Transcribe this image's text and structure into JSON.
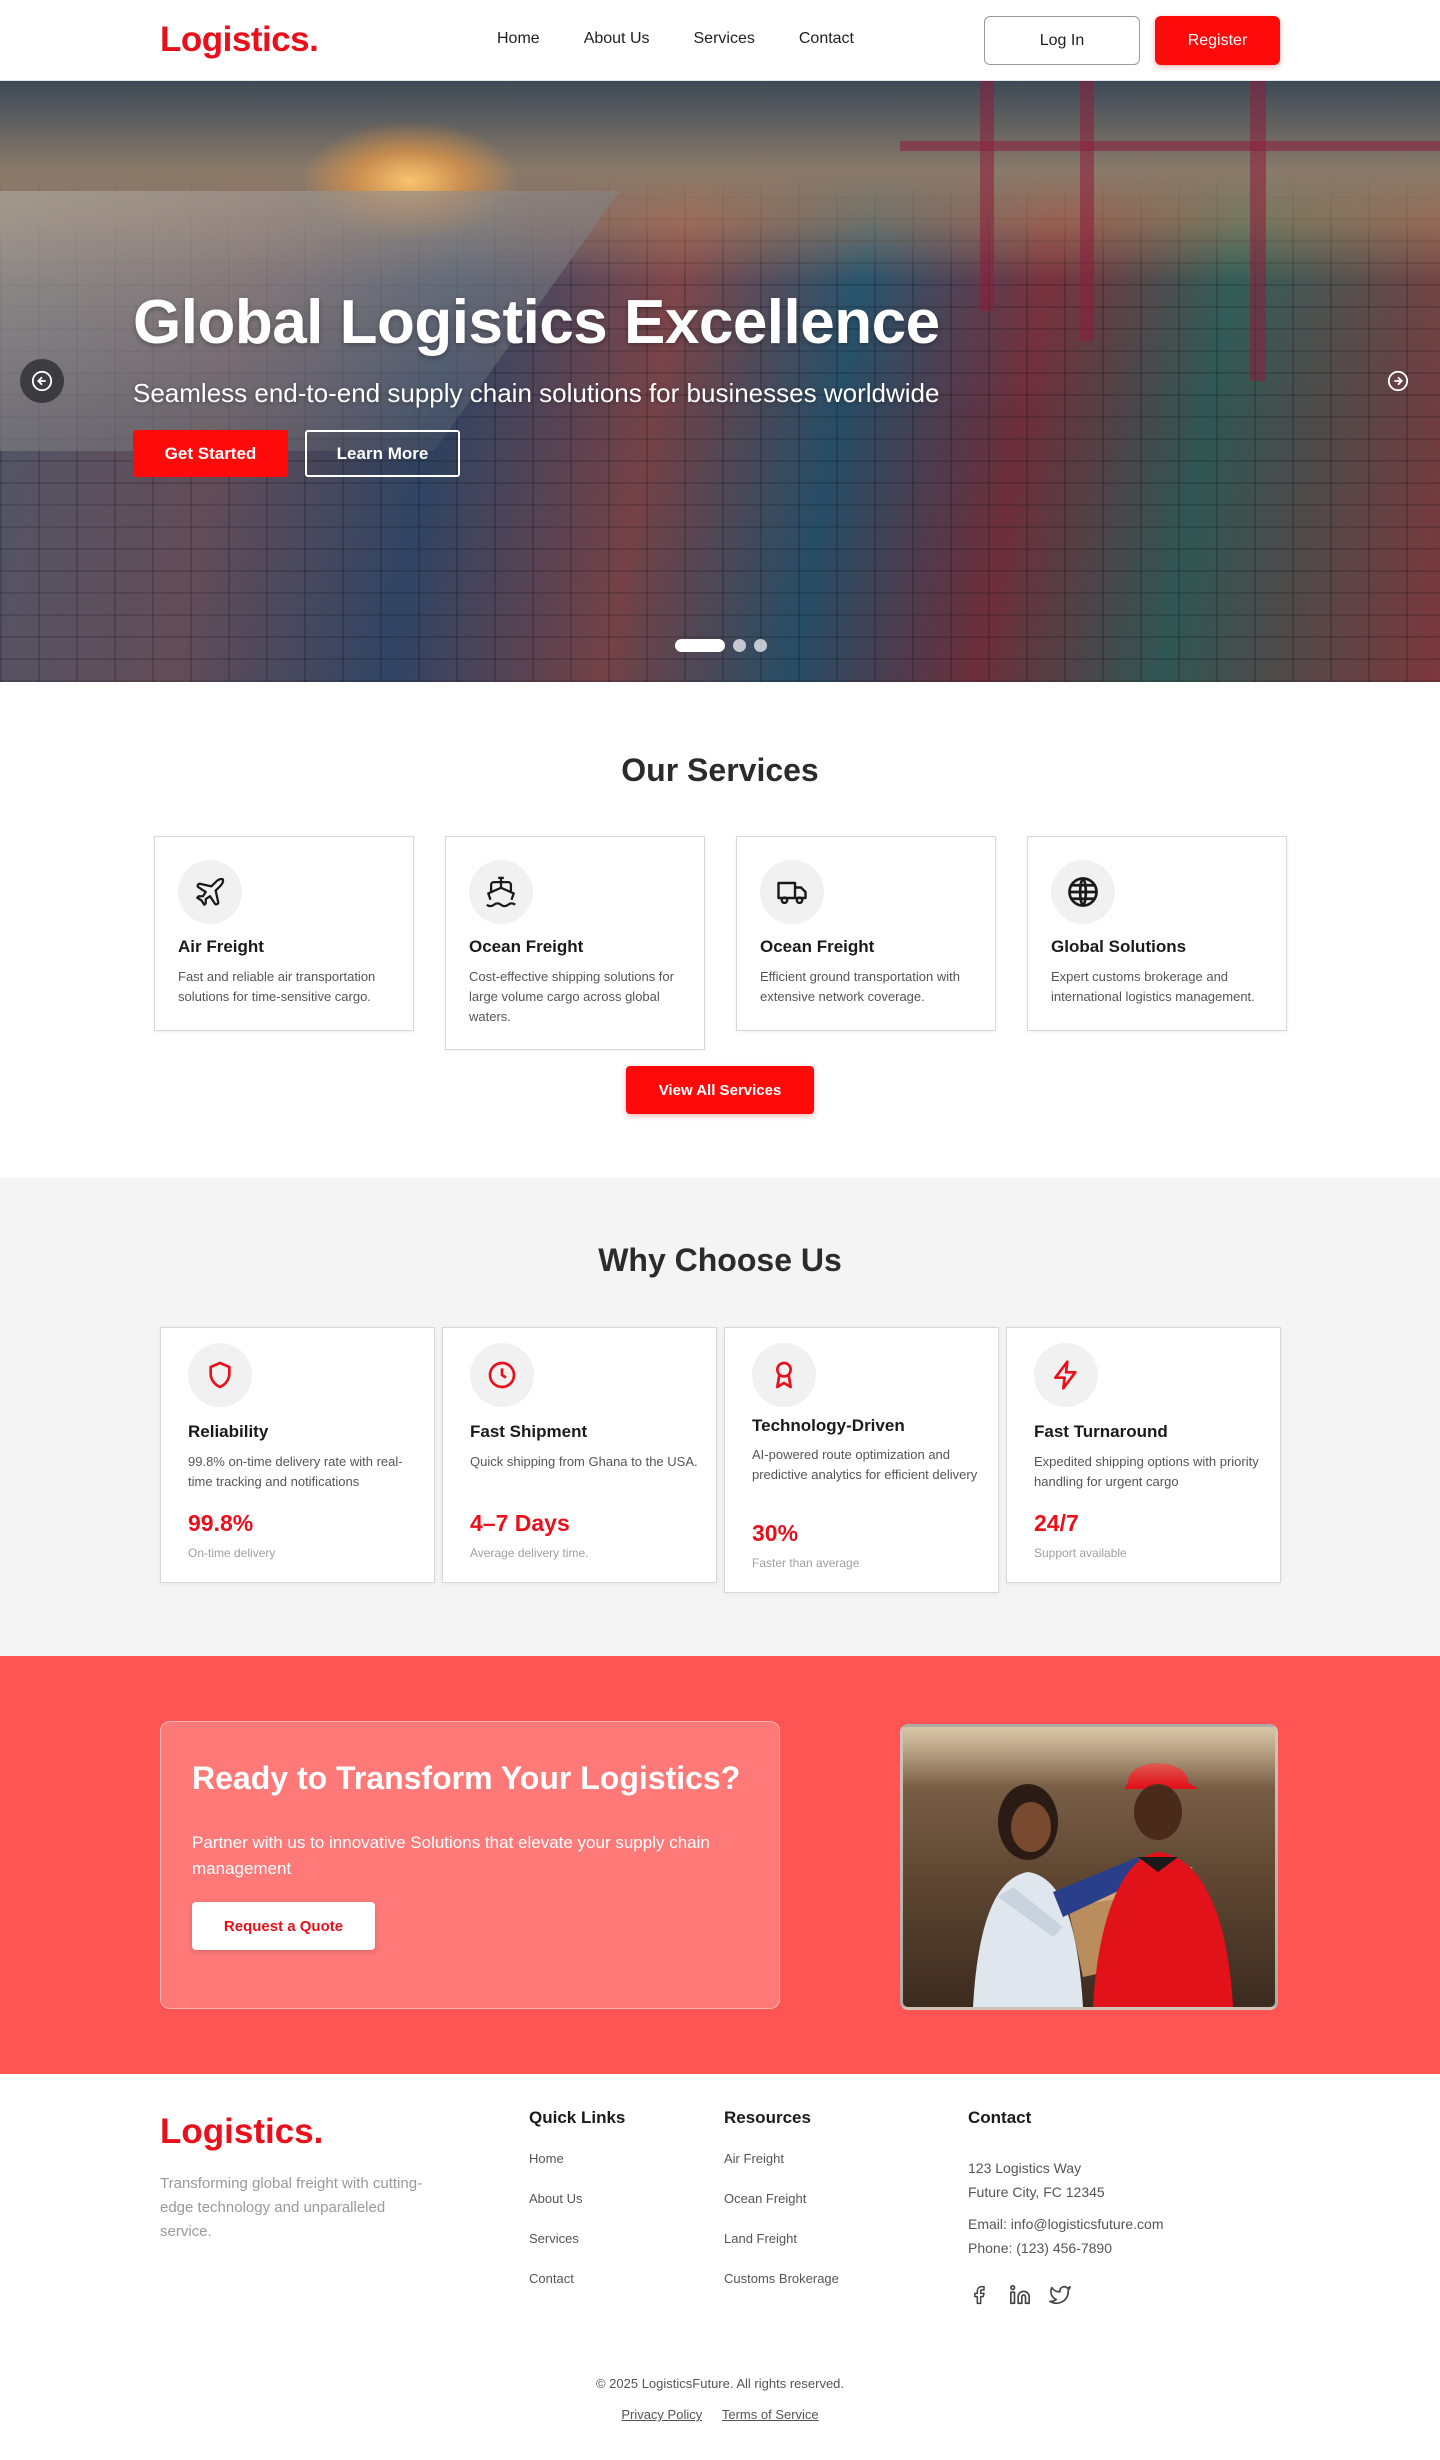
{
  "header": {
    "logo": "Logistics.",
    "nav": [
      "Home",
      "About Us",
      "Services",
      "Contact"
    ],
    "login_label": "Log In",
    "register_label": "Register"
  },
  "hero": {
    "title": "Global Logistics Excellence",
    "subtitle": "Seamless end-to-end supply chain solutions for businesses worldwide",
    "primary_button": "Get Started",
    "secondary_button": "Learn More",
    "slide_count": 3,
    "active_slide": 1
  },
  "services": {
    "title": "Our Services",
    "cards": [
      {
        "icon": "airplane-icon",
        "name": "Air Freight",
        "desc": "Fast and reliable air transportation solutions for time-sensitive cargo."
      },
      {
        "icon": "ship-icon",
        "name": "Ocean Freight",
        "desc": "Cost-effective shipping solutions for large volume cargo across global waters."
      },
      {
        "icon": "truck-icon",
        "name": "Ocean Freight",
        "desc": "Efficient ground transportation with extensive network coverage."
      },
      {
        "icon": "globe-icon",
        "name": "Global Solutions",
        "desc": "Expert customs brokerage and international logistics management."
      }
    ],
    "button": "View All Services"
  },
  "why": {
    "title": "Why Choose Us",
    "cards": [
      {
        "icon": "shield-icon",
        "name": "Reliability",
        "desc": "99.8% on-time delivery rate with real-time tracking and notifications",
        "value": "99.8%",
        "caption": "On-time delivery"
      },
      {
        "icon": "clock-icon",
        "name": "Fast Shipment",
        "desc": "Quick shipping from Ghana to the USA.",
        "value": "4–7 Days",
        "caption": "Average delivery time."
      },
      {
        "icon": "award-icon",
        "name": "Technology-Driven",
        "desc": "AI-powered route optimization and predictive analytics for efficient delivery",
        "value": "30%",
        "caption": "Faster than average"
      },
      {
        "icon": "lightning-icon",
        "name": "Fast Turnaround",
        "desc": "Expedited shipping options with priority handling for urgent cargo",
        "value": "24/7",
        "caption": "Support available"
      }
    ]
  },
  "cta": {
    "title": "Ready to Transform Your Logistics?",
    "text": "Partner with us to innovative Solutions that elevate your supply chain management",
    "button": "Request a Quote"
  },
  "footer": {
    "logo": "Logistics.",
    "tagline": "Transforming global freight with cutting-edge technology and unparalleled service.",
    "quick_links_title": "Quick Links",
    "quick_links": [
      "Home",
      "About Us",
      "Services",
      "Contact"
    ],
    "resources_title": "Resources",
    "resources": [
      "Air Freight",
      "Ocean Freight",
      "Land Freight",
      "Customs Brokerage"
    ],
    "contact_title": "Contact",
    "address_line1": "123 Logistics Way",
    "address_line2": "Future City, FC 12345",
    "email": "Email: info@logisticsfuture.com",
    "phone": "Phone: (123) 456-7890",
    "social": [
      "facebook-icon",
      "linkedin-icon",
      "twitter-icon"
    ],
    "copyright": "© 2025 LogisticsFuture. All rights reserved.",
    "privacy": "Privacy Policy",
    "terms": "Terms of Service"
  },
  "colors": {
    "brand_red": "#e8111b",
    "button_red": "#ff0a0a",
    "cta_background": "#ff5454"
  }
}
